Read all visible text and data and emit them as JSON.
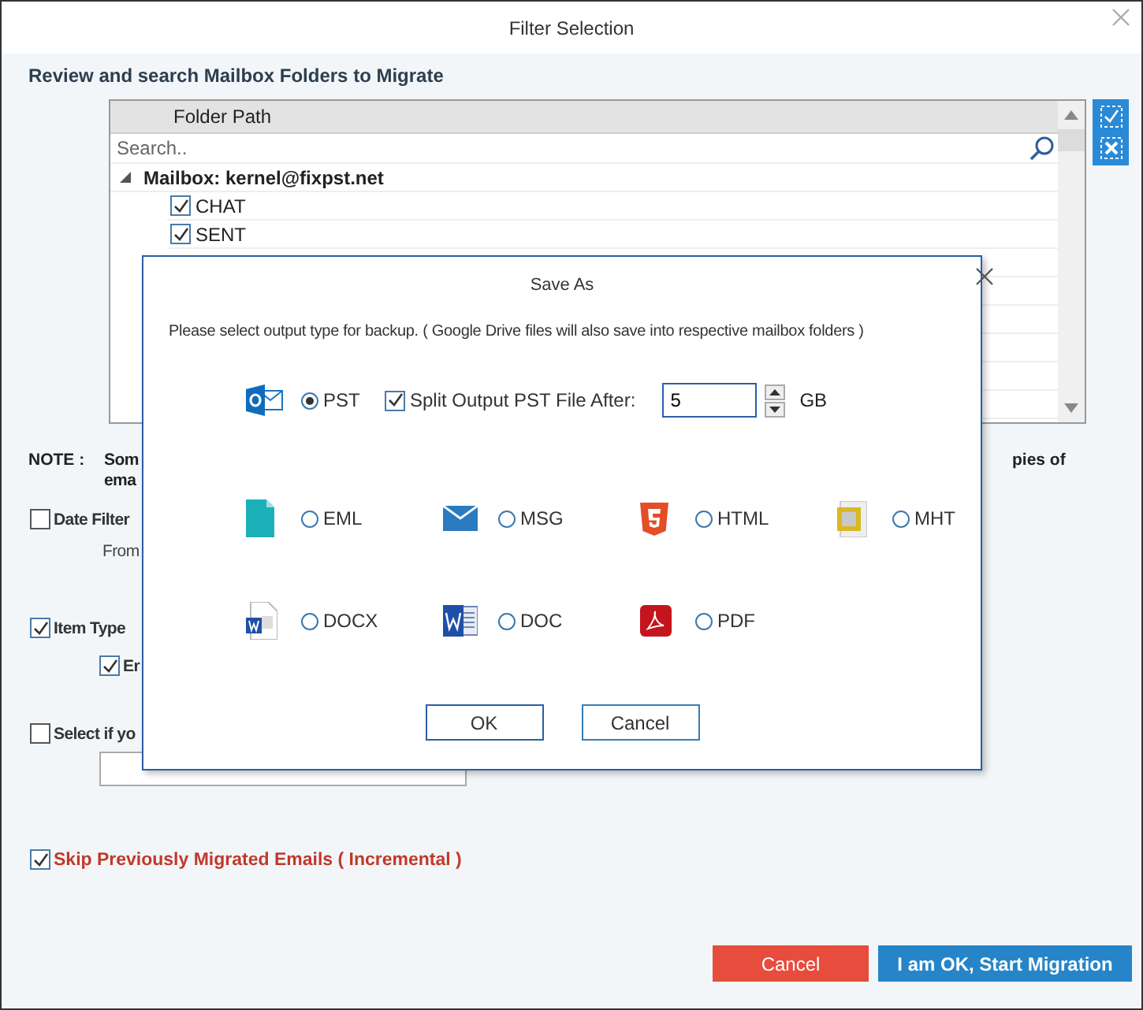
{
  "window": {
    "title": "Filter Selection"
  },
  "heading": "Review and search Mailbox Folders to Migrate",
  "folder_tree": {
    "column": "Folder Path",
    "search": {
      "placeholder": "Search.."
    },
    "mailbox": {
      "label": "Mailbox: kernel@fixpst.net",
      "expanded": true,
      "children": [
        {
          "label": "CHAT",
          "checked": true
        },
        {
          "label": "SENT",
          "checked": true
        }
      ]
    }
  },
  "note": {
    "label": "NOTE :",
    "text_1": "Som",
    "text_2": "ema",
    "text_3": "pies of"
  },
  "options": [
    {
      "kind": "checkbox",
      "label": "Date Filter",
      "checked": false
    },
    {
      "kind": "text",
      "label": "From"
    },
    {
      "kind": "checkbox",
      "label": "Item Type",
      "checked": true
    },
    {
      "kind": "subcheckbox",
      "label": "Er",
      "checked": true
    },
    {
      "kind": "checkbox",
      "label": "Select if yo",
      "checked": false
    },
    {
      "kind": "field"
    },
    {
      "kind": "incremental",
      "label": "Skip Previously Migrated Emails ( Incremental )",
      "checked": true
    }
  ],
  "buttons": [
    {
      "kind": "cancel",
      "label": "Cancel"
    },
    {
      "kind": "primary",
      "label": "I am OK, Start Migration"
    }
  ],
  "dialog": {
    "title": "Save As",
    "message": "Please select output type for backup. ( Google Drive files will also save into respective mailbox folders )",
    "pst": {
      "label": "PST",
      "selected": true
    },
    "split": {
      "label": "Split Output PST File After:",
      "checked": true,
      "value": "5",
      "unit": "GB"
    },
    "formats": [
      {
        "kind": "eml",
        "label": "EML",
        "selected": false
      },
      {
        "kind": "msg",
        "label": "MSG",
        "selected": false
      },
      {
        "kind": "html",
        "label": "HTML",
        "selected": false
      },
      {
        "kind": "mht",
        "label": "MHT",
        "selected": false
      },
      {
        "kind": "docx",
        "label": "DOCX",
        "selected": false
      },
      {
        "kind": "doc",
        "label": "DOC",
        "selected": false
      },
      {
        "kind": "pdf",
        "label": "PDF",
        "selected": false
      }
    ],
    "buttons": [
      "OK",
      "Cancel"
    ]
  }
}
